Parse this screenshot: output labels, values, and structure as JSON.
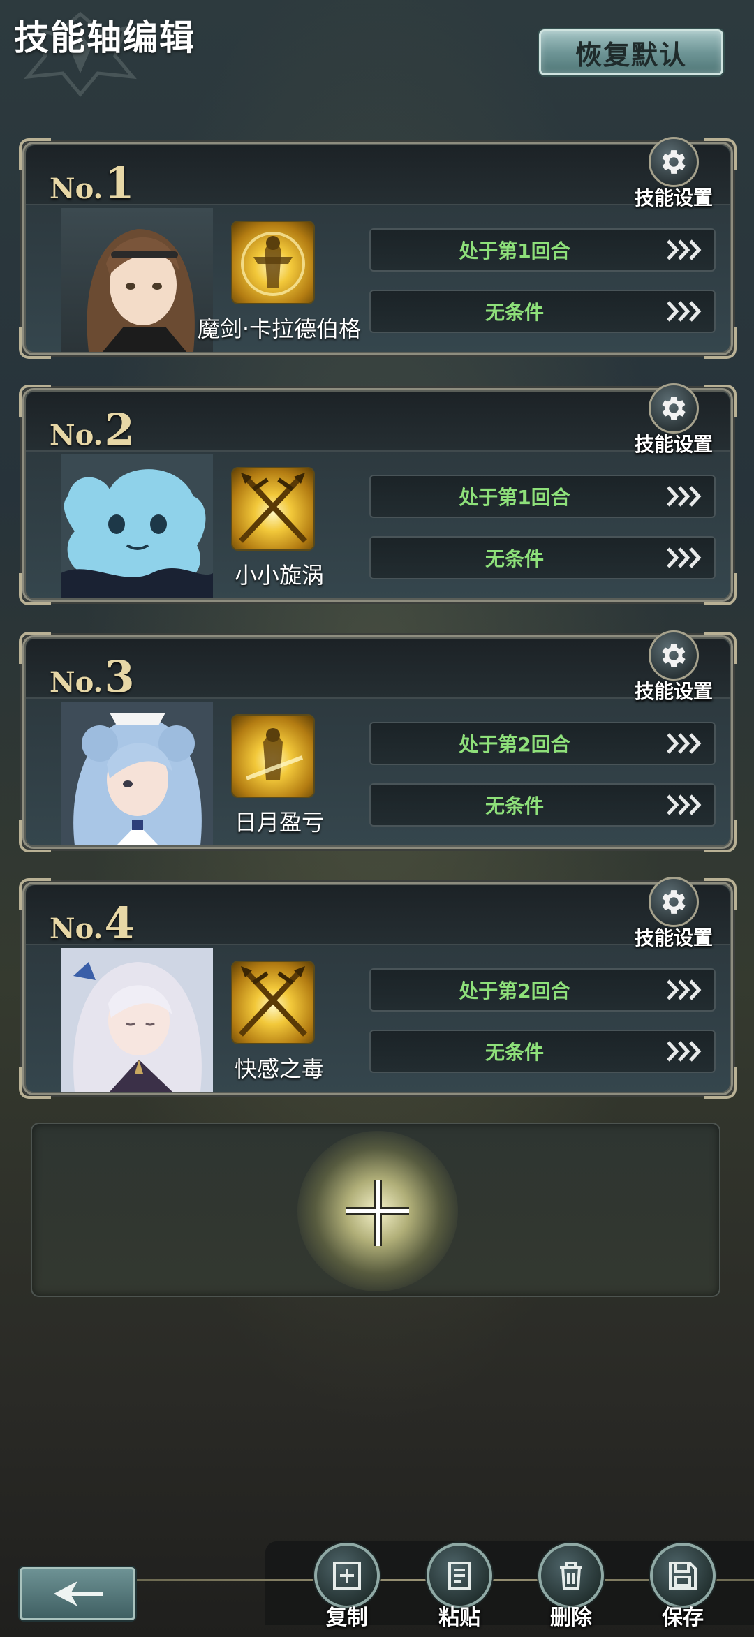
{
  "header": {
    "title": "技能轴编辑",
    "reset_label": "恢复默认"
  },
  "common": {
    "skill_settings_label": "技能设置",
    "number_prefix": "No."
  },
  "slots": [
    {
      "number": "1",
      "character": "brown-haired-girl",
      "skill_name": "魔剑·卡拉德伯格",
      "skill_icon": "golden-warrior",
      "conditions": [
        "处于第1回合",
        "无条件"
      ]
    },
    {
      "number": "2",
      "character": "blue-jellyfish",
      "skill_name": "小小旋涡",
      "skill_icon": "crossed-spears",
      "conditions": [
        "处于第1回合",
        "无条件"
      ]
    },
    {
      "number": "3",
      "character": "blue-haired-maid",
      "skill_name": "日月盈亏",
      "skill_icon": "golden-warrior",
      "conditions": [
        "处于第2回合",
        "无条件"
      ]
    },
    {
      "number": "4",
      "character": "white-haired-girl",
      "skill_name": "快感之毒",
      "skill_icon": "crossed-spears",
      "conditions": [
        "处于第2回合",
        "无条件"
      ]
    }
  ],
  "toolbar": {
    "copy": "复制",
    "paste": "粘贴",
    "delete": "删除",
    "save": "保存"
  },
  "colors": {
    "condition_text": "#8ee07a",
    "number_gold": "#e7d7a6",
    "accent_teal": "#6f9697"
  }
}
